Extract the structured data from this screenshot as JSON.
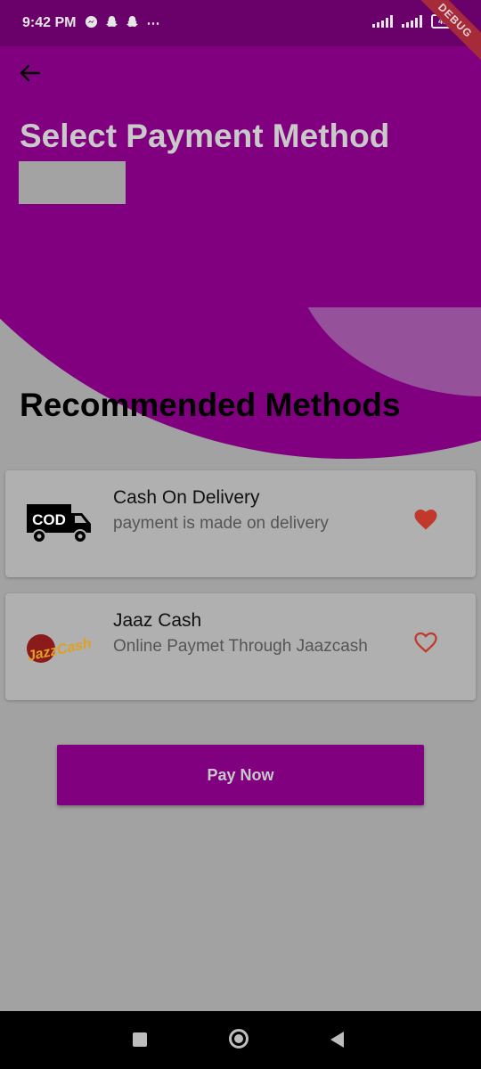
{
  "status_bar": {
    "time": "9:42 PM",
    "icons": [
      "messenger-icon",
      "snapchat-icon",
      "snapchat-icon",
      "more-icon"
    ],
    "battery": "46",
    "debug_label": "DEBUG"
  },
  "header": {
    "back_icon": "arrow-left-icon",
    "title": "Select Payment Method"
  },
  "section": {
    "title": "Recommended Methods"
  },
  "payment_methods": [
    {
      "title": "Cash On Delivery",
      "subtitle": "payment is made on delivery",
      "logo_text": "COD",
      "favorite": true
    },
    {
      "title": "Jaaz Cash",
      "subtitle": "Online Paymet Through Jaazcash",
      "logo_text": "JazzCash",
      "favorite": false
    }
  ],
  "pay_button": {
    "label": "Pay Now"
  },
  "colors": {
    "primary": "#800080",
    "accent": "#95529a",
    "heart": "#c0392b",
    "background": "#a2a2a2"
  }
}
